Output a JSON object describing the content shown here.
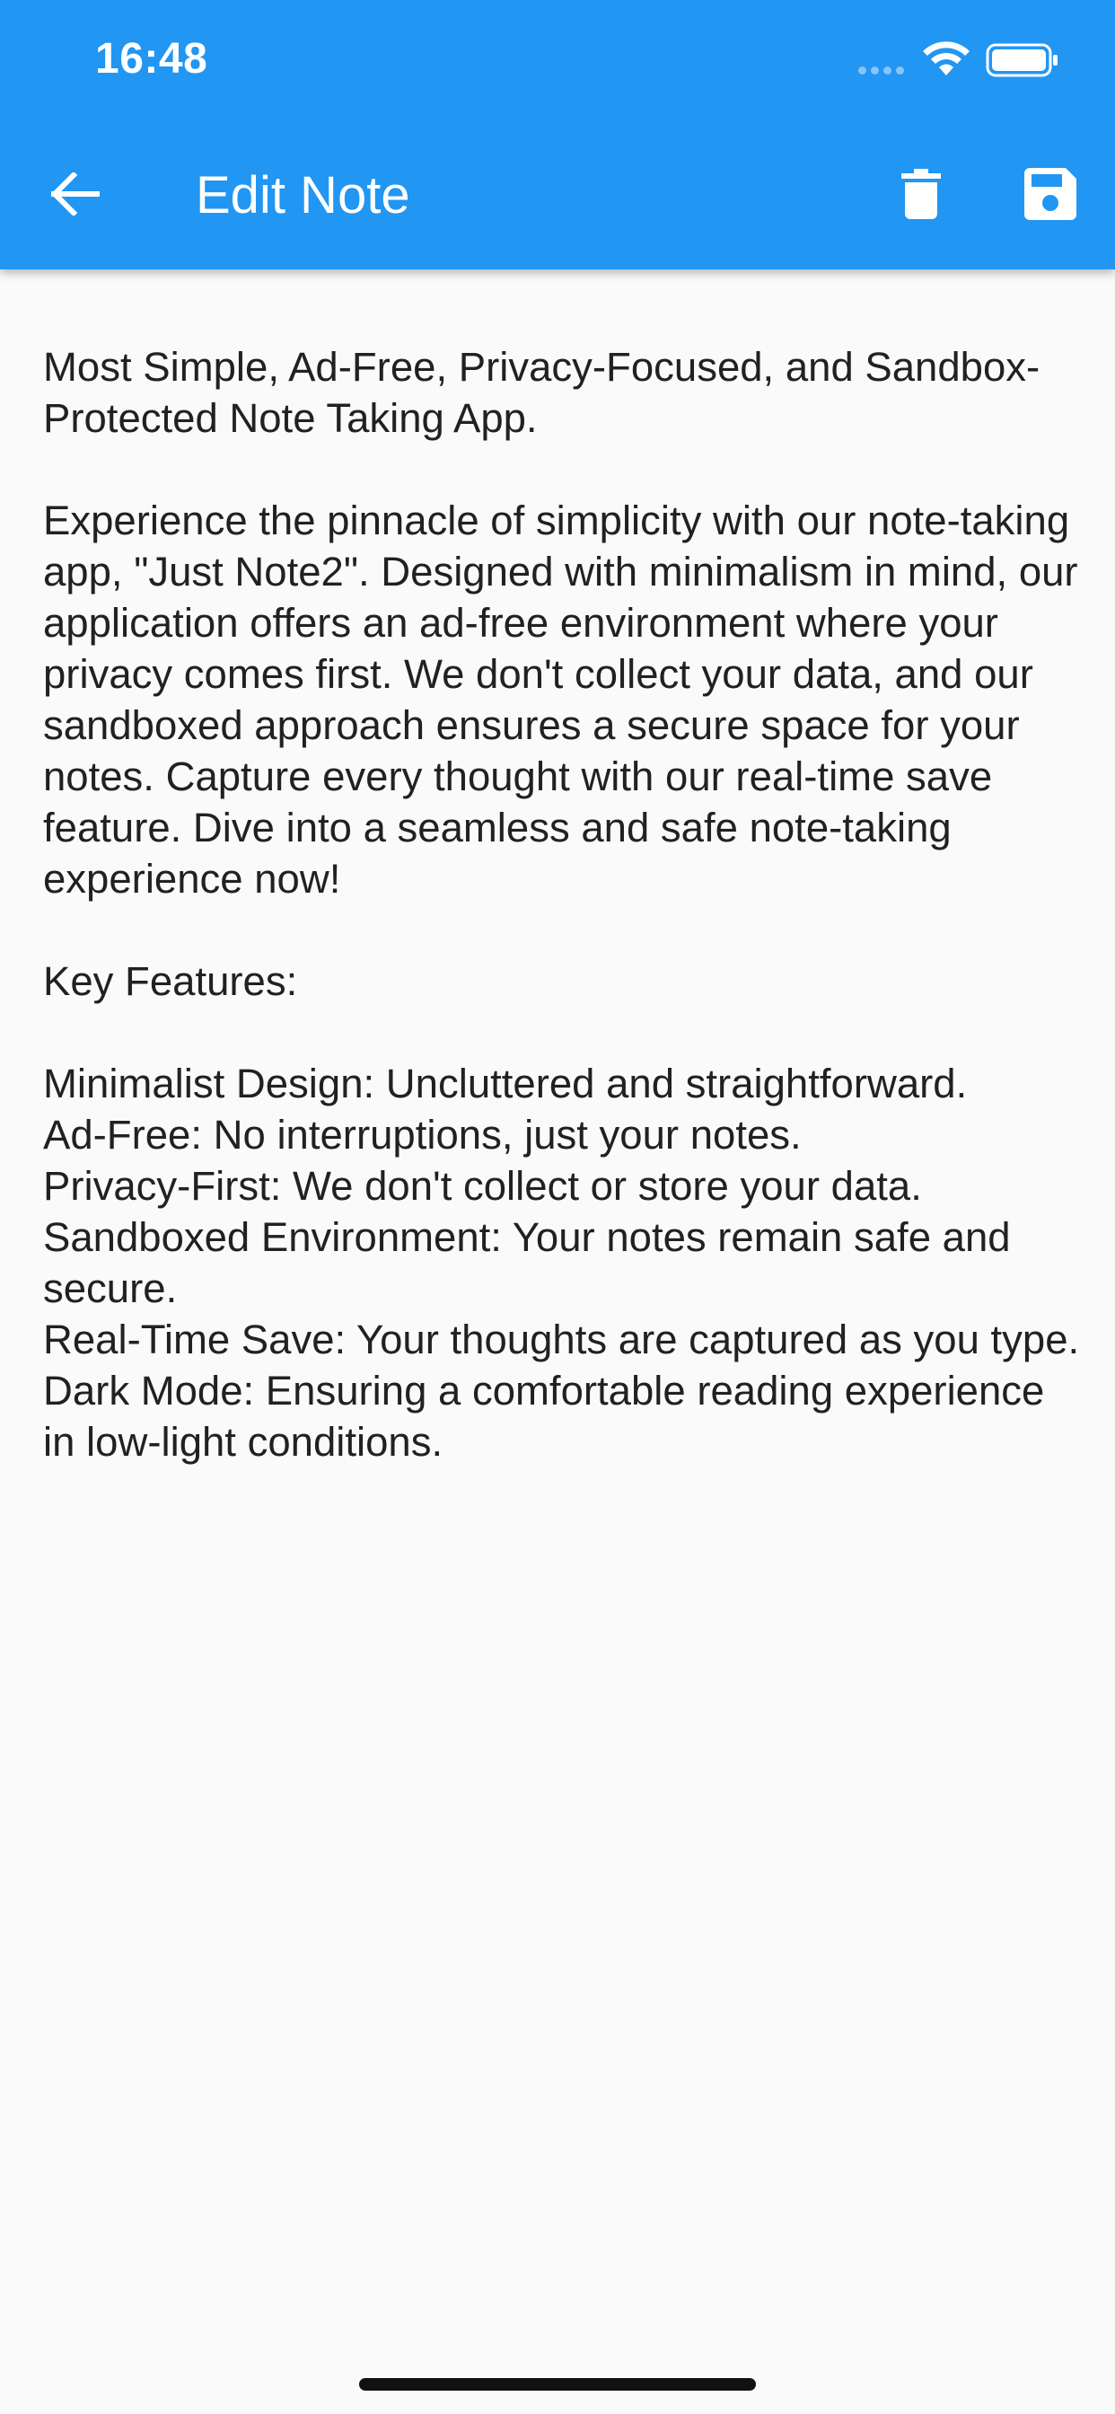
{
  "status_bar": {
    "time": "16:48"
  },
  "app_bar": {
    "title": "Edit Note",
    "color": "#2196f3"
  },
  "icons": {
    "back": "arrow-back-icon",
    "delete": "trash-icon",
    "save": "floppy-disk-icon",
    "wifi": "wifi-icon",
    "battery": "battery-icon"
  },
  "note": {
    "content": "Most Simple, Ad-Free, Privacy-Focused, and Sandbox-Protected Note Taking App.\n\nExperience the pinnacle of simplicity with our note-taking app, \"Just Note2\". Designed with minimalism in mind, our application offers an ad-free environment where your privacy comes first. We don't collect your data, and our sandboxed approach ensures a secure space for your notes. Capture every thought with our real-time save feature. Dive into a seamless and safe note-taking experience now!\n\nKey Features:\n\nMinimalist Design: Uncluttered and straightforward.\nAd-Free: No interruptions, just your notes.\nPrivacy-First: We don't collect or store your data.\nSandboxed Environment: Your notes remain safe and secure.\nReal-Time Save: Your thoughts are captured as you type.\nDark Mode: Ensuring a comfortable reading experience in low-light conditions."
  }
}
